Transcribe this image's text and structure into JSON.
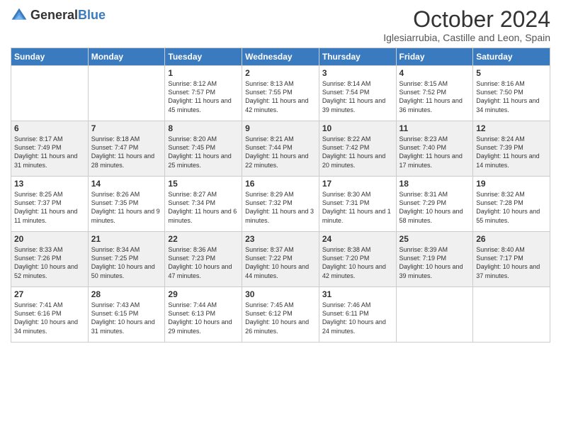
{
  "logo": {
    "text_general": "General",
    "text_blue": "Blue"
  },
  "header": {
    "month_year": "October 2024",
    "location": "Iglesiarrubia, Castille and Leon, Spain"
  },
  "weekdays": [
    "Sunday",
    "Monday",
    "Tuesday",
    "Wednesday",
    "Thursday",
    "Friday",
    "Saturday"
  ],
  "weeks": [
    [
      {
        "day": "",
        "info": ""
      },
      {
        "day": "",
        "info": ""
      },
      {
        "day": "1",
        "info": "Sunrise: 8:12 AM\nSunset: 7:57 PM\nDaylight: 11 hours and 45 minutes."
      },
      {
        "day": "2",
        "info": "Sunrise: 8:13 AM\nSunset: 7:55 PM\nDaylight: 11 hours and 42 minutes."
      },
      {
        "day": "3",
        "info": "Sunrise: 8:14 AM\nSunset: 7:54 PM\nDaylight: 11 hours and 39 minutes."
      },
      {
        "day": "4",
        "info": "Sunrise: 8:15 AM\nSunset: 7:52 PM\nDaylight: 11 hours and 36 minutes."
      },
      {
        "day": "5",
        "info": "Sunrise: 8:16 AM\nSunset: 7:50 PM\nDaylight: 11 hours and 34 minutes."
      }
    ],
    [
      {
        "day": "6",
        "info": "Sunrise: 8:17 AM\nSunset: 7:49 PM\nDaylight: 11 hours and 31 minutes."
      },
      {
        "day": "7",
        "info": "Sunrise: 8:18 AM\nSunset: 7:47 PM\nDaylight: 11 hours and 28 minutes."
      },
      {
        "day": "8",
        "info": "Sunrise: 8:20 AM\nSunset: 7:45 PM\nDaylight: 11 hours and 25 minutes."
      },
      {
        "day": "9",
        "info": "Sunrise: 8:21 AM\nSunset: 7:44 PM\nDaylight: 11 hours and 22 minutes."
      },
      {
        "day": "10",
        "info": "Sunrise: 8:22 AM\nSunset: 7:42 PM\nDaylight: 11 hours and 20 minutes."
      },
      {
        "day": "11",
        "info": "Sunrise: 8:23 AM\nSunset: 7:40 PM\nDaylight: 11 hours and 17 minutes."
      },
      {
        "day": "12",
        "info": "Sunrise: 8:24 AM\nSunset: 7:39 PM\nDaylight: 11 hours and 14 minutes."
      }
    ],
    [
      {
        "day": "13",
        "info": "Sunrise: 8:25 AM\nSunset: 7:37 PM\nDaylight: 11 hours and 11 minutes."
      },
      {
        "day": "14",
        "info": "Sunrise: 8:26 AM\nSunset: 7:35 PM\nDaylight: 11 hours and 9 minutes."
      },
      {
        "day": "15",
        "info": "Sunrise: 8:27 AM\nSunset: 7:34 PM\nDaylight: 11 hours and 6 minutes."
      },
      {
        "day": "16",
        "info": "Sunrise: 8:29 AM\nSunset: 7:32 PM\nDaylight: 11 hours and 3 minutes."
      },
      {
        "day": "17",
        "info": "Sunrise: 8:30 AM\nSunset: 7:31 PM\nDaylight: 11 hours and 1 minute."
      },
      {
        "day": "18",
        "info": "Sunrise: 8:31 AM\nSunset: 7:29 PM\nDaylight: 10 hours and 58 minutes."
      },
      {
        "day": "19",
        "info": "Sunrise: 8:32 AM\nSunset: 7:28 PM\nDaylight: 10 hours and 55 minutes."
      }
    ],
    [
      {
        "day": "20",
        "info": "Sunrise: 8:33 AM\nSunset: 7:26 PM\nDaylight: 10 hours and 52 minutes."
      },
      {
        "day": "21",
        "info": "Sunrise: 8:34 AM\nSunset: 7:25 PM\nDaylight: 10 hours and 50 minutes."
      },
      {
        "day": "22",
        "info": "Sunrise: 8:36 AM\nSunset: 7:23 PM\nDaylight: 10 hours and 47 minutes."
      },
      {
        "day": "23",
        "info": "Sunrise: 8:37 AM\nSunset: 7:22 PM\nDaylight: 10 hours and 44 minutes."
      },
      {
        "day": "24",
        "info": "Sunrise: 8:38 AM\nSunset: 7:20 PM\nDaylight: 10 hours and 42 minutes."
      },
      {
        "day": "25",
        "info": "Sunrise: 8:39 AM\nSunset: 7:19 PM\nDaylight: 10 hours and 39 minutes."
      },
      {
        "day": "26",
        "info": "Sunrise: 8:40 AM\nSunset: 7:17 PM\nDaylight: 10 hours and 37 minutes."
      }
    ],
    [
      {
        "day": "27",
        "info": "Sunrise: 7:41 AM\nSunset: 6:16 PM\nDaylight: 10 hours and 34 minutes."
      },
      {
        "day": "28",
        "info": "Sunrise: 7:43 AM\nSunset: 6:15 PM\nDaylight: 10 hours and 31 minutes."
      },
      {
        "day": "29",
        "info": "Sunrise: 7:44 AM\nSunset: 6:13 PM\nDaylight: 10 hours and 29 minutes."
      },
      {
        "day": "30",
        "info": "Sunrise: 7:45 AM\nSunset: 6:12 PM\nDaylight: 10 hours and 26 minutes."
      },
      {
        "day": "31",
        "info": "Sunrise: 7:46 AM\nSunset: 6:11 PM\nDaylight: 10 hours and 24 minutes."
      },
      {
        "day": "",
        "info": ""
      },
      {
        "day": "",
        "info": ""
      }
    ]
  ]
}
